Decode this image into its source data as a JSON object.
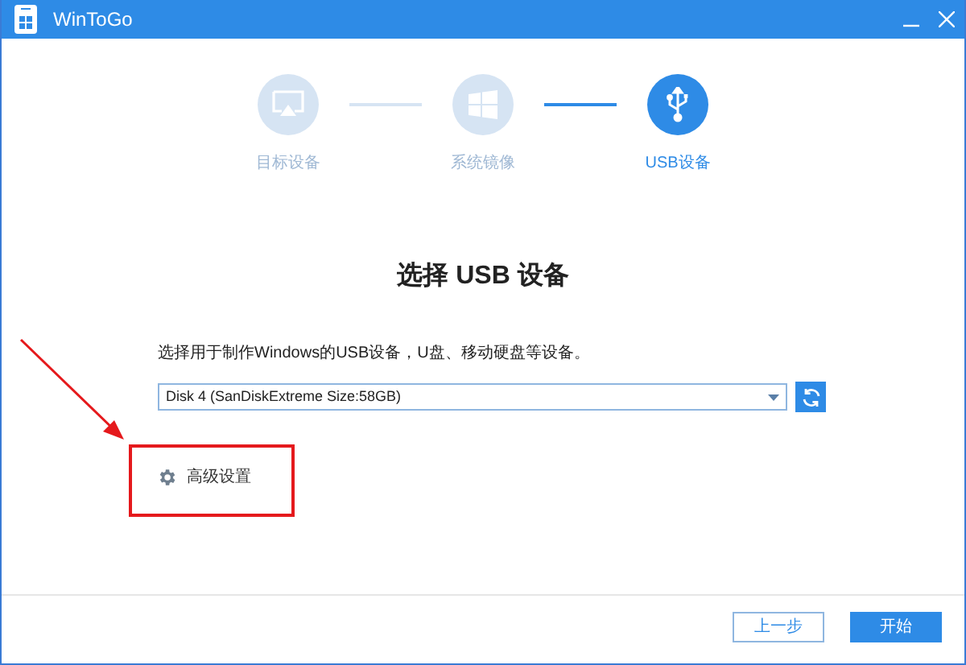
{
  "window": {
    "title": "WinToGo"
  },
  "steps": [
    {
      "kind": "monitor",
      "label": "目标设备",
      "selected": false
    },
    {
      "kind": "windows",
      "label": "系统镜像",
      "selected": false
    },
    {
      "kind": "usb",
      "label": "USB设备",
      "selected": true
    }
  ],
  "heading": "选择 USB 设备",
  "instruction": "选择用于制作Windows的USB设备，U盘、移动硬盘等设备。",
  "device_select": {
    "value": "Disk 4 (SanDiskExtreme Size:58GB)"
  },
  "advanced": {
    "label": "高级设置",
    "highlighted": true
  },
  "buttons": [
    {
      "label": "上一步",
      "kind": "secondary"
    },
    {
      "label": "开始",
      "kind": "primary"
    }
  ]
}
